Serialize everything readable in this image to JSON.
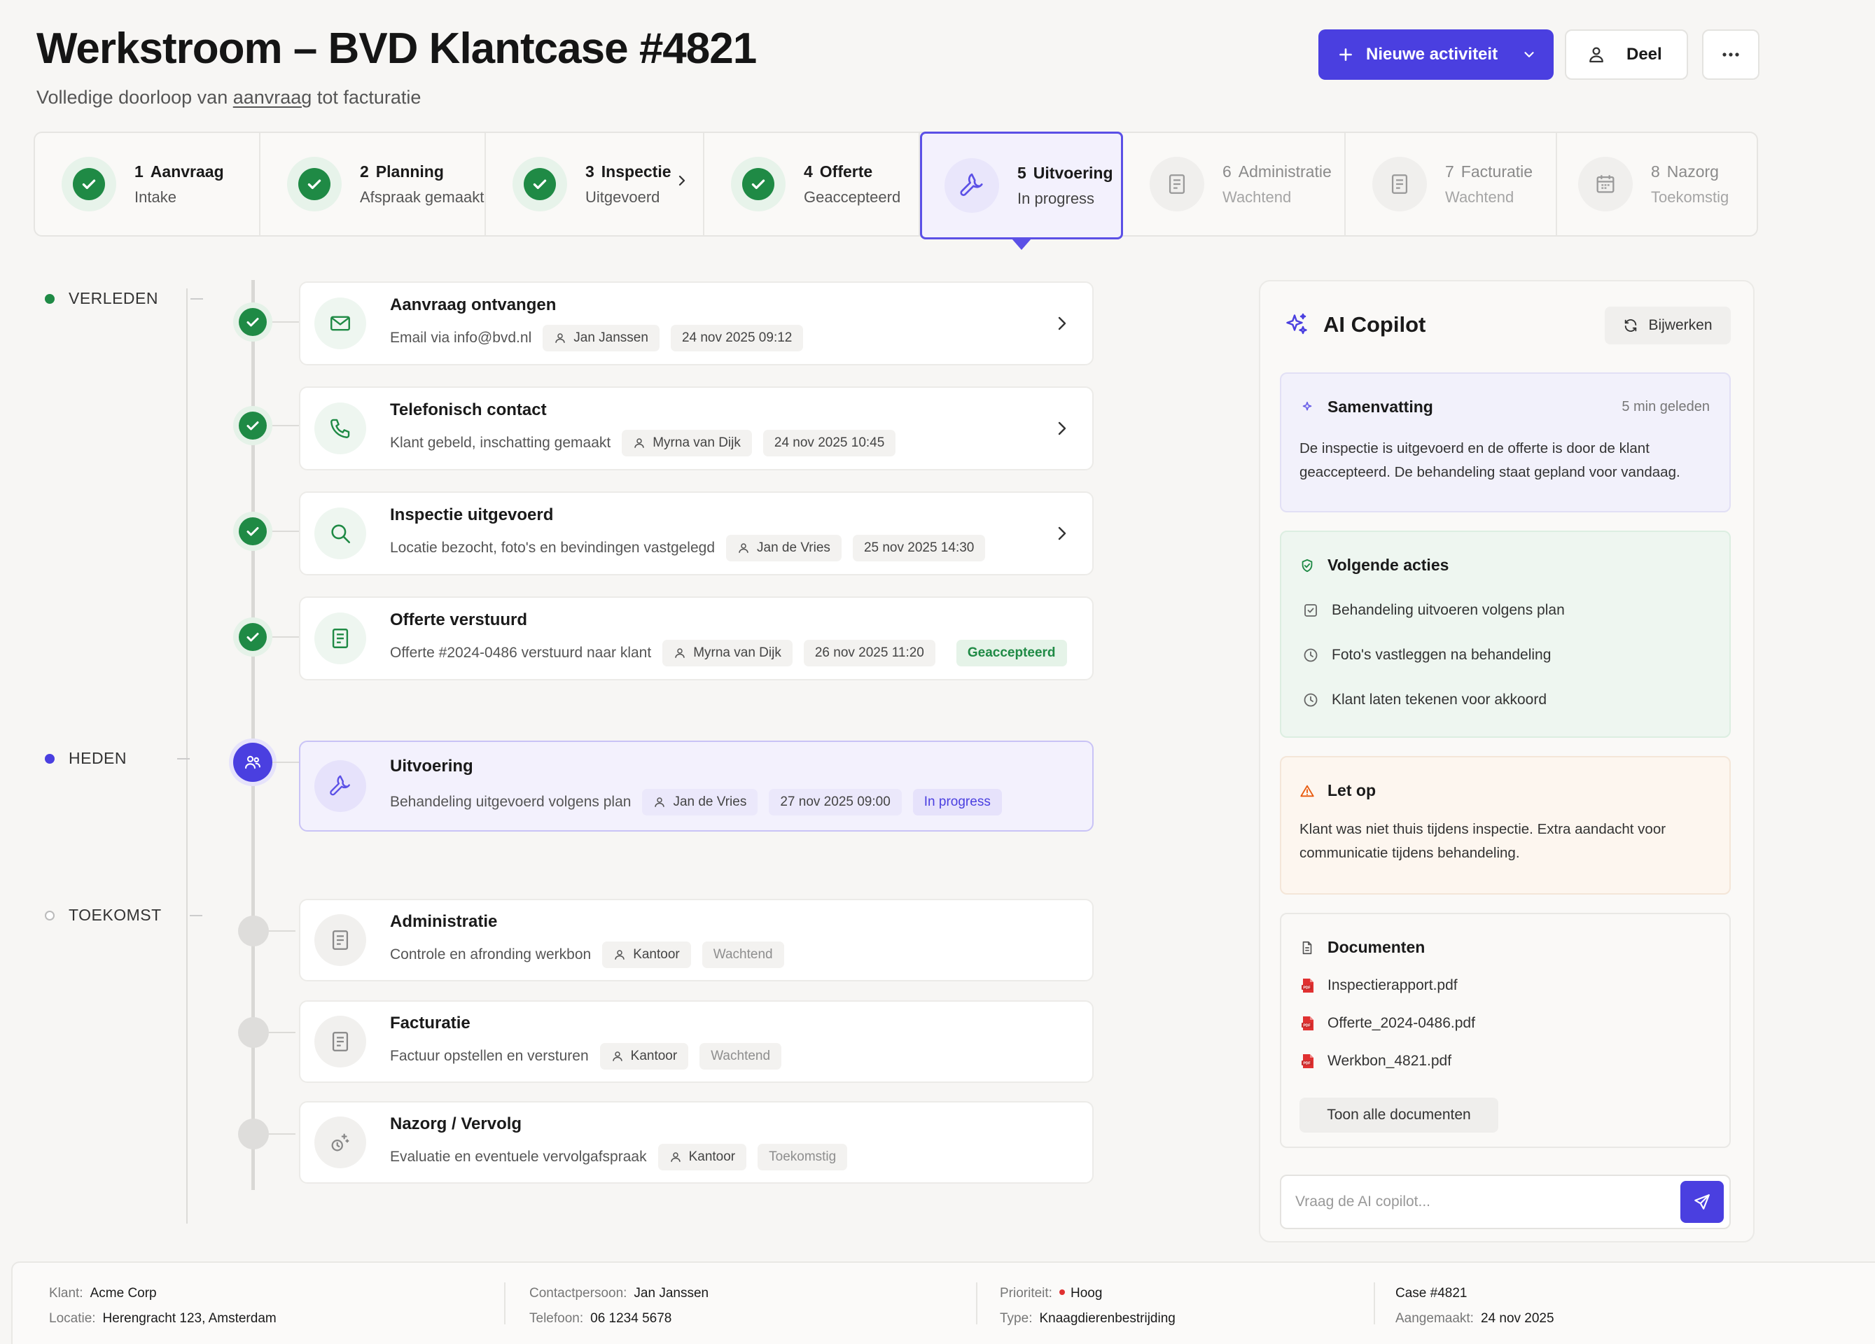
{
  "header": {
    "title": "Werkstroom – BVD Klantcase #4821",
    "subtitle_pre": "Volledige doorloop van ",
    "subtitle_link": "aanvraag",
    "subtitle_post": " tot facturatie",
    "primary_button": "Nieuwe activiteit",
    "share_button": "Deel"
  },
  "steps": [
    {
      "num": "1",
      "title": "Aanvraag",
      "sub": "Intake",
      "state": "done"
    },
    {
      "num": "2",
      "title": "Planning",
      "sub": "Afspraak gemaakt",
      "state": "done"
    },
    {
      "num": "3",
      "title": "Inspectie",
      "sub": "Uitgevoerd",
      "state": "done"
    },
    {
      "num": "4",
      "title": "Offerte",
      "sub": "Geaccepteerd",
      "state": "done"
    },
    {
      "num": "5",
      "title": "Uitvoering",
      "sub": "In progress",
      "state": "active"
    },
    {
      "num": "6",
      "title": "Administratie",
      "sub": "Wachtend",
      "state": "pending"
    },
    {
      "num": "7",
      "title": "Facturatie",
      "sub": "Wachtend",
      "state": "pending"
    },
    {
      "num": "8",
      "title": "Nazorg",
      "sub": "Toekomstig",
      "state": "pending"
    }
  ],
  "timeline_labels": {
    "past": "VERLEDEN",
    "present": "HEDEN",
    "future": "TOEKOMST"
  },
  "activities": [
    {
      "title": "Aanvraag ontvangen",
      "desc": "Email via info@bvd.nl",
      "person": "Jan Janssen",
      "date": "24 nov 2025 09:12"
    },
    {
      "title": "Telefonisch contact",
      "desc": "Klant gebeld, inschatting gemaakt",
      "person": "Myrna van Dijk",
      "date": "24 nov 2025 10:45"
    },
    {
      "title": "Inspectie uitgevoerd",
      "desc": "Locatie bezocht, foto's en bevindingen vastgelegd",
      "person": "Jan de Vries",
      "date": "25 nov 2025 14:30"
    },
    {
      "title": "Offerte verstuurd",
      "desc": "Offerte #2024-0486 verstuurd naar klant",
      "person": "Myrna van Dijk",
      "date": "26 nov 2025 11:20",
      "status": "Geaccepteerd"
    },
    {
      "title": "Uitvoering",
      "desc": "Behandeling uitgevoerd volgens plan",
      "person": "Jan de Vries",
      "date": "27 nov 2025 09:00",
      "status": "In progress"
    },
    {
      "title": "Administratie",
      "desc": "Controle en afronding werkbon",
      "person": "Kantoor",
      "status": "Wachtend"
    },
    {
      "title": "Facturatie",
      "desc": "Factuur opstellen en versturen",
      "person": "Kantoor",
      "status": "Wachtend"
    },
    {
      "title": "Nazorg / Vervolg",
      "desc": "Evaluatie en eventuele vervolgafspraak",
      "person": "Kantoor",
      "status": "Toekomstig"
    }
  ],
  "copilot": {
    "title": "AI Copilot",
    "update_button": "Bijwerken",
    "summary": {
      "title": "Samenvatting",
      "time": "5 min geleden",
      "text": "De inspectie is uitgevoerd en de offerte is door de klant geaccepteerd. De behandeling staat gepland voor vandaag."
    },
    "next_actions": {
      "title": "Volgende acties",
      "items": [
        "Behandeling uitvoeren volgens plan",
        "Foto's vastleggen na behandeling",
        "Klant laten tekenen voor akkoord"
      ]
    },
    "warning": {
      "title": "Let op",
      "text": "Klant was niet thuis tijdens inspectie. Extra aandacht voor communicatie tijdens behandeling."
    },
    "documents": {
      "title": "Documenten",
      "items": [
        "Inspectierapport.pdf",
        "Offerte_2024-0486.pdf",
        "Werkbon_4821.pdf"
      ],
      "show_all": "Toon alle documenten"
    },
    "chat_placeholder": "Vraag de AI copilot..."
  },
  "footer": {
    "client_label": "Klant:",
    "client": "Acme Corp",
    "location_label": "Locatie:",
    "location": "Herengracht 123, Amsterdam",
    "contact_label": "Contactpersoon:",
    "contact": "Jan Janssen",
    "phone_label": "Telefoon:",
    "phone": "06 1234 5678",
    "priority_label": "Prioriteit:",
    "priority": "Hoog",
    "type_label": "Type:",
    "type": "Knaagdierenbestrijding",
    "case": "Case #4821",
    "created_label": "Aangemaakt:",
    "created": "24 nov 2025"
  },
  "colors": {
    "accent": "#4a3fe0",
    "done": "#1f8a45",
    "warning": "#e8590c",
    "priority": "#e03131"
  }
}
